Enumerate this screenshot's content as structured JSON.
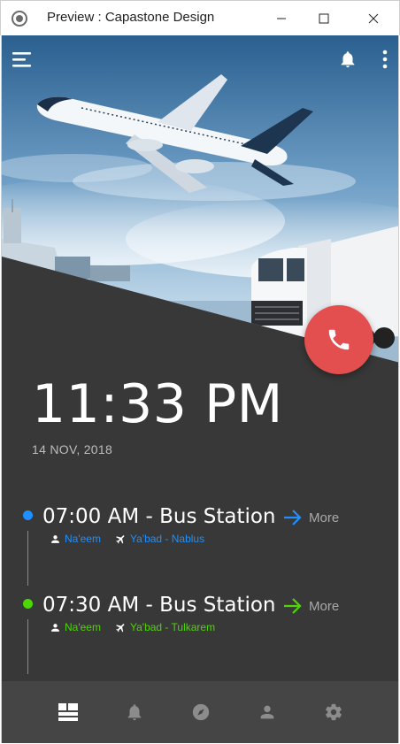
{
  "window": {
    "title": "Preview : Capastone Design"
  },
  "clock": {
    "time": "11:33 PM",
    "date": "14 NOV, 2018"
  },
  "trips": [
    {
      "time_title": "07:00 AM - Bus Station",
      "person": "Na'eem",
      "route": "Ya'bad - Nablus",
      "more_label": "More",
      "color": "#1e90ff"
    },
    {
      "time_title": "07:30 AM - Bus Station",
      "person": "Na'eem",
      "route": "Ya'bad - Tulkarem",
      "more_label": "More",
      "color": "#4cd700"
    }
  ],
  "icons": {
    "top": [
      "menu-icon",
      "bell-icon",
      "more-vertical-icon"
    ],
    "fab": "phone-icon",
    "bottom_nav": [
      "dashboard-icon",
      "bell-icon",
      "compass-icon",
      "person-icon",
      "settings-icon"
    ]
  },
  "colors": {
    "background": "#383838",
    "bottom_nav": "#454545",
    "call_button": "#e34f4f",
    "trip_1": "#1e90ff",
    "trip_2": "#4cd700"
  }
}
